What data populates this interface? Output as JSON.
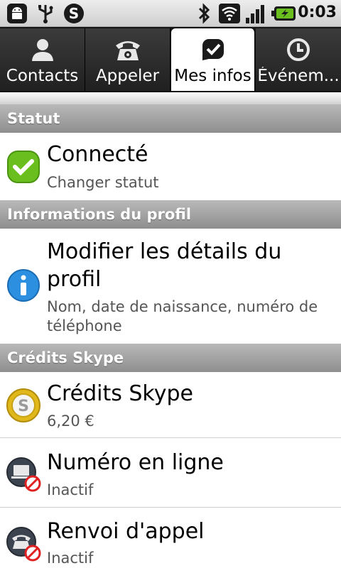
{
  "status_bar": {
    "time": "0:03",
    "left_icons": [
      "android-icon",
      "usb-icon",
      "skype-icon"
    ],
    "right_icons": [
      "bluetooth-icon",
      "wifi-icon",
      "signal-icon",
      "battery-icon"
    ]
  },
  "tabs": [
    {
      "label": "Contacts",
      "icon": "contact-icon",
      "active": false
    },
    {
      "label": "Appeler",
      "icon": "phone-icon",
      "active": false
    },
    {
      "label": "Mes infos",
      "icon": "myinfo-icon",
      "active": true
    },
    {
      "label": "Événem...",
      "icon": "clock-icon",
      "active": false
    }
  ],
  "sections": {
    "statut": {
      "header": "Statut",
      "item": {
        "title": "Connecté",
        "subtitle": "Changer statut",
        "icon": "online-status-icon"
      }
    },
    "profil": {
      "header": "Informations du profil",
      "item": {
        "title_line1": "Modifier les détails du",
        "title_line2": "profil",
        "subtitle_line1": "Nom, date de naissance, numéro de",
        "subtitle_line2": "téléphone",
        "icon": "info-icon"
      }
    },
    "credits": {
      "header": "Crédits Skype",
      "items": [
        {
          "title": "Crédits Skype",
          "subtitle": "6,20 €",
          "icon": "skype-credit-icon"
        },
        {
          "title": "Numéro en ligne",
          "subtitle": "Inactif",
          "icon": "online-number-icon"
        },
        {
          "title": "Renvoi d'appel",
          "subtitle": "Inactif",
          "icon": "call-forward-icon"
        }
      ]
    }
  },
  "colors": {
    "section_header": "#9f9f9f",
    "tab_active": "#ffffff",
    "status_green": "#6abf1e",
    "info_blue": "#2d8fe0",
    "credit_gold": "#e0b81a",
    "disabled_red": "#e02020"
  }
}
